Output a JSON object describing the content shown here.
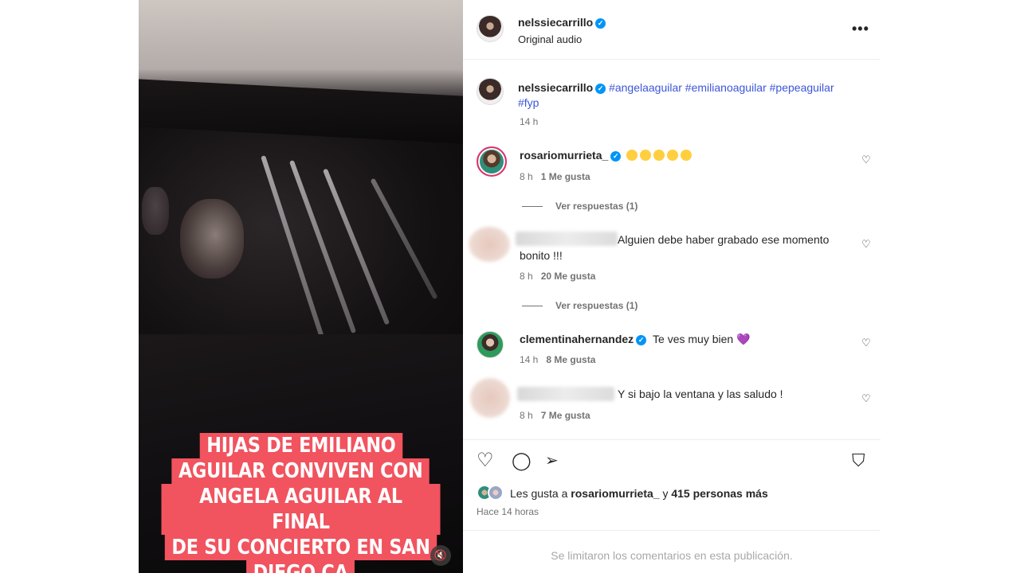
{
  "video": {
    "caption_lines": [
      "HIJAS DE EMILIANO",
      "AGUILAR CONVIVEN CON",
      "ANGELA AGUILAR AL FINAL",
      "DE SU CONCIERTO EN SAN",
      "DIEGO CA"
    ],
    "mute_icon": "🔇"
  },
  "header": {
    "username": "nelssiecarrillo",
    "audio": "Original audio",
    "more_icon": "•••"
  },
  "post": {
    "username": "nelssiecarrillo",
    "hashtags_line1": "#angelaaguilar #emilianoaguilar #pepeaguilar",
    "hashtags_line2": "#fyp",
    "time": "14 h"
  },
  "comments": [
    {
      "username": "rosariomurrieta_",
      "text": "",
      "time": "8 h",
      "likes": "1 Me gusta",
      "replies": "Ver respuestas (1)"
    },
    {
      "username": "",
      "text_line1": "Alguien debe haber grabado ese momento",
      "text_line2": "bonito !!!",
      "time": "8 h",
      "likes": "20 Me gusta",
      "replies": "Ver respuestas (1)"
    },
    {
      "username": "clementinahernandez",
      "text": "Te ves muy bien",
      "emoji": "💜",
      "time": "14 h",
      "likes": "8 Me gusta"
    },
    {
      "username": "",
      "text": "Y si bajo la ventana y las saludo !",
      "time": "8 h",
      "likes": "7 Me gusta"
    }
  ],
  "actions": {
    "like_icon": "♡",
    "comment_icon": "◯",
    "share_icon": "➢",
    "save_icon": "⛉"
  },
  "likes": {
    "prefix": "Les gusta a ",
    "user": "rosariomurrieta_",
    "middle": " y ",
    "count": "415 personas más",
    "posted": "Hace 14 horas"
  },
  "footer": {
    "note": "Se limitaron los comentarios en esta publicación."
  },
  "colors": {
    "caption_bg": "#f1535f",
    "verified": "#0095f6",
    "hashtag": "#3d55d9"
  }
}
